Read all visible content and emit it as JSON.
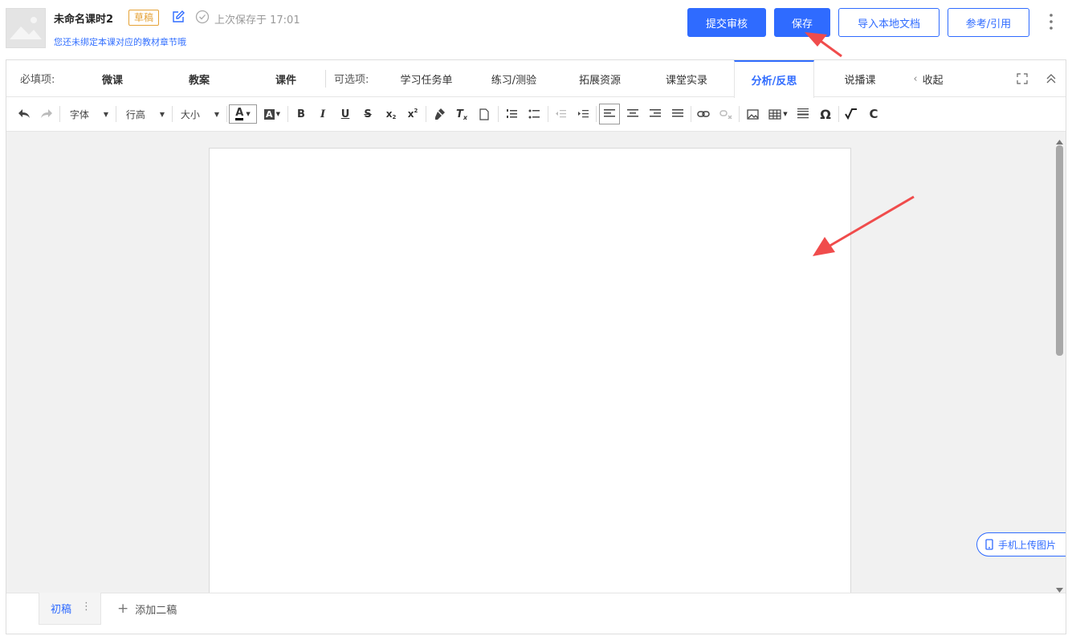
{
  "header": {
    "title": "未命名课时2",
    "badge": "草稿",
    "save_status": "上次保存于 17:01",
    "chapter_link": "您还未绑定本课对应的教材章节哦"
  },
  "actions": {
    "submit": "提交审核",
    "save": "保存",
    "import": "导入本地文档",
    "reference": "参考/引用"
  },
  "tabs": {
    "required_label": "必填项:",
    "required": [
      "微课",
      "教案",
      "课件"
    ],
    "optional_label": "可选项:",
    "optional": [
      "学习任务单",
      "练习/测验",
      "拓展资源",
      "课堂实录",
      "分析/反思",
      "说播课"
    ],
    "active": "分析/反思",
    "collapse": "收起"
  },
  "toolbar": {
    "font": "字体",
    "line_height": "行高",
    "size": "大小"
  },
  "side": {
    "mobile_upload": "手机上传图片"
  },
  "drafts": {
    "current": "初稿",
    "add": "添加二稿"
  },
  "colors": {
    "primary": "#2f6bff",
    "badge": "#e5a236",
    "annotation_arrow": "#f04c4c"
  }
}
